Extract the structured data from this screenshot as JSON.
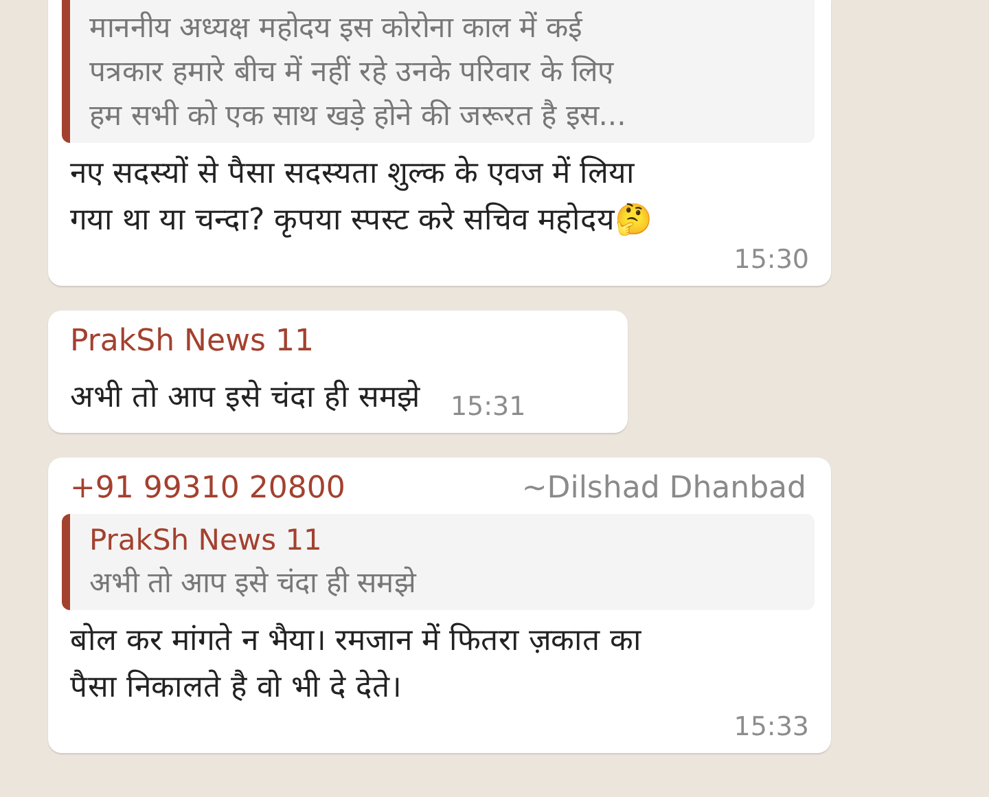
{
  "messages": [
    {
      "kind": "reply",
      "quote": {
        "text": "माननीय अध्यक्ष महोदय इस कोरोना काल में कई\nपत्रकार हमारे बीच में नहीं रहे  उनके परिवार के लिए\nहम सभी को एक साथ खड़े  होने की जरूरत  है इस..."
      },
      "text": "नए सदस्यों से पैसा सदस्यता शुल्क के एवज में लिया\nगया था या चन्दा? कृपया स्पस्ट करे सचिव महोदय🤔",
      "time": "15:30"
    },
    {
      "kind": "plain",
      "sender": "PrakSh News 11",
      "text": "अभी तो आप इसे चंदा ही समझे",
      "time": "15:31"
    },
    {
      "kind": "reply",
      "sender": "+91 99310 20800",
      "sender_alias": "~Dilshad Dhanbad",
      "quote": {
        "sender": "PrakSh News 11",
        "text": "अभी तो आप इसे चंदा ही समझे"
      },
      "text": "बोल कर मांगते न भैया। रमजान में फितरा ज़कात का\nपैसा निकालते है वो भी दे देते।",
      "time": "15:33"
    }
  ]
}
